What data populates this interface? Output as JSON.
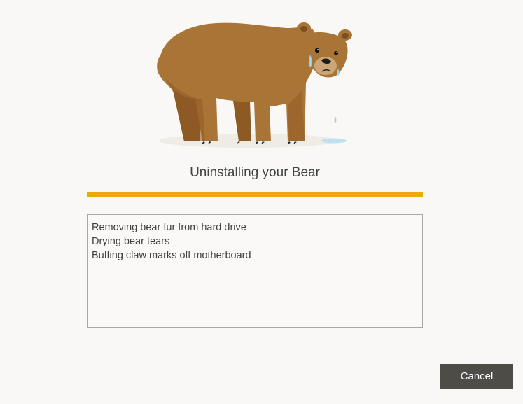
{
  "installer": {
    "title": "Uninstalling your Bear",
    "progress": 1.0,
    "accent_color": "#e9a913",
    "log_lines": [
      "Removing bear fur from hard drive",
      "Drying bear tears",
      "Buffing claw marks off motherboard"
    ],
    "cancel_label": "Cancel",
    "illustration": "crying-bear-illustration"
  }
}
